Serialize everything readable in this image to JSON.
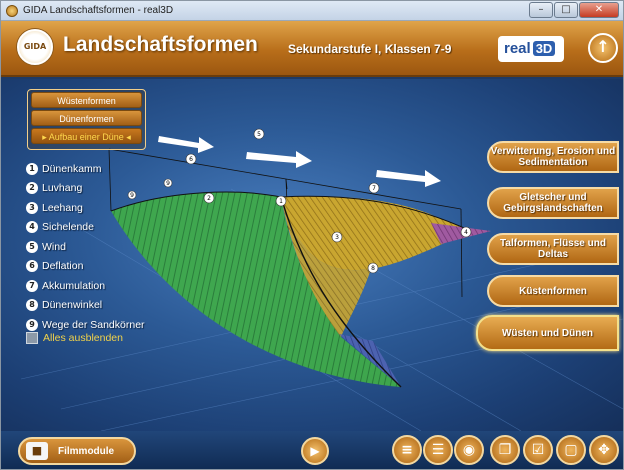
{
  "window": {
    "title": "GIDA Landschaftsformen - real3D",
    "minimize": "–",
    "maximize": "□",
    "close": "✕"
  },
  "header": {
    "logo": "GIDA",
    "title": "Landschaftsformen",
    "subtitle": "Sekundarstufe I, Klassen 7-9",
    "brand": "real",
    "brand_3d": "3D",
    "up_icon": "arrow-up-icon"
  },
  "submenu": {
    "items": [
      {
        "label": "Wüstenformen",
        "active": false
      },
      {
        "label": "Dünenformen",
        "active": false
      },
      {
        "label": "▸ Aufbau einer Düne ◂",
        "active": true
      }
    ]
  },
  "legend": {
    "items": [
      {
        "num": "1",
        "label": "Dünenkamm"
      },
      {
        "num": "2",
        "label": "Luvhang"
      },
      {
        "num": "3",
        "label": "Leehang"
      },
      {
        "num": "4",
        "label": "Sichelende"
      },
      {
        "num": "5",
        "label": "Wind"
      },
      {
        "num": "6",
        "label": "Deflation"
      },
      {
        "num": "7",
        "label": "Akkumulation"
      },
      {
        "num": "8",
        "label": "Dünenwinkel"
      },
      {
        "num": "9",
        "label": "Wege der Sandkörner"
      }
    ],
    "hide_all": "Alles ausblenden"
  },
  "topics": [
    {
      "label": "Verwitterung, Erosion und Sedimentation",
      "active": false
    },
    {
      "label": "Gletscher und Gebirgslandschaften",
      "active": false
    },
    {
      "label": "Talformen, Flüsse und Deltas",
      "active": false
    },
    {
      "label": "Küstenformen",
      "active": false
    },
    {
      "label": "Wüsten und Dünen",
      "active": true
    }
  ],
  "markers": [
    "1",
    "2",
    "3",
    "4",
    "5",
    "6",
    "7",
    "8",
    "9",
    "9"
  ],
  "footer": {
    "film_label": "Filmmodule",
    "tools": [
      "list-icon",
      "text-list-icon",
      "camera-icon",
      "copy-icon",
      "checklist-icon",
      "window-icon",
      "move-icon"
    ]
  },
  "colors": {
    "accent": "#c4781f",
    "background": "#2c5a96",
    "luv_green": "#3faa4a",
    "lee_yellow": "#c9a630",
    "highlight": "#f1d24a"
  }
}
